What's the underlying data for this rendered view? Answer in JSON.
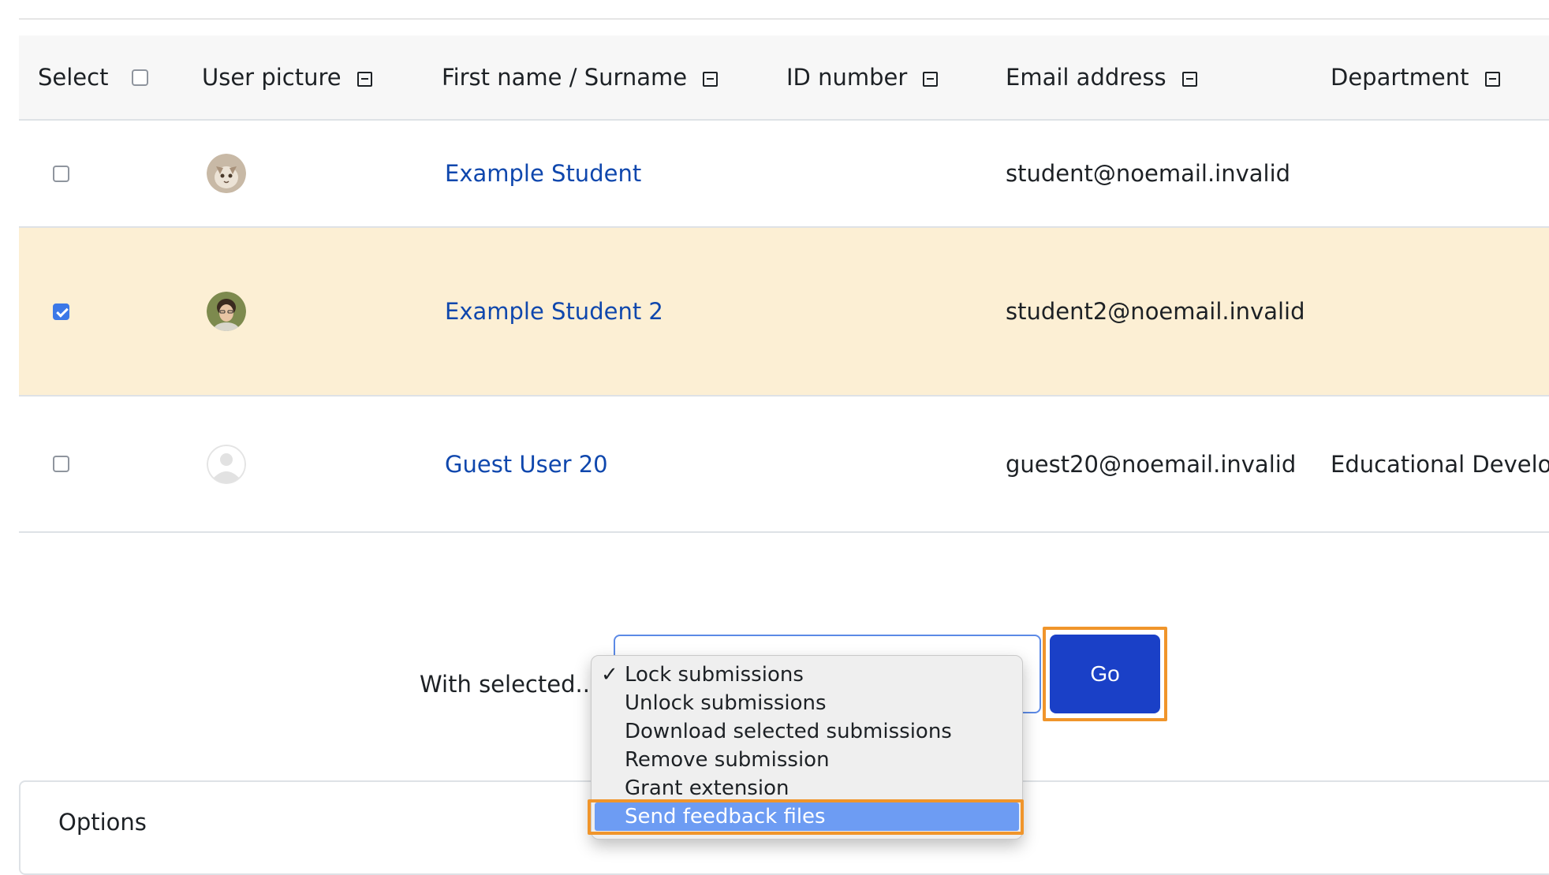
{
  "table": {
    "headers": {
      "select": "Select",
      "user_picture": "User picture",
      "name": "First name / Surname",
      "id_number": "ID number",
      "email": "Email address",
      "department": "Department"
    },
    "rows": [
      {
        "selected": false,
        "name": "Example Student",
        "id_number": "",
        "email": "student@noemail.invalid",
        "department": "",
        "avatar": "cat-avatar"
      },
      {
        "selected": true,
        "name": "Example Student 2",
        "id_number": "",
        "email": "student2@noemail.invalid",
        "department": "",
        "avatar": "person-avatar"
      },
      {
        "selected": false,
        "name": "Guest User 20",
        "id_number": "",
        "email": "guest20@noemail.invalid",
        "department": "Educational Develop",
        "avatar": "default-avatar"
      }
    ]
  },
  "bulk": {
    "label": "With selected...",
    "go_label": "Go",
    "options": [
      {
        "label": "Lock submissions",
        "checked": true,
        "active": false
      },
      {
        "label": "Unlock submissions",
        "checked": false,
        "active": false
      },
      {
        "label": "Download selected submissions",
        "checked": false,
        "active": false
      },
      {
        "label": "Remove submission",
        "checked": false,
        "active": false
      },
      {
        "label": "Grant extension",
        "checked": false,
        "active": false
      },
      {
        "label": "Send feedback files",
        "checked": false,
        "active": true
      }
    ]
  },
  "options_section": {
    "title": "Options"
  },
  "colors": {
    "link": "#0f47ad",
    "selected_row": "#fcefd4",
    "go_button": "#1a40c7",
    "highlight_outline": "#f0952b",
    "active_option": "#6d9cf3"
  }
}
